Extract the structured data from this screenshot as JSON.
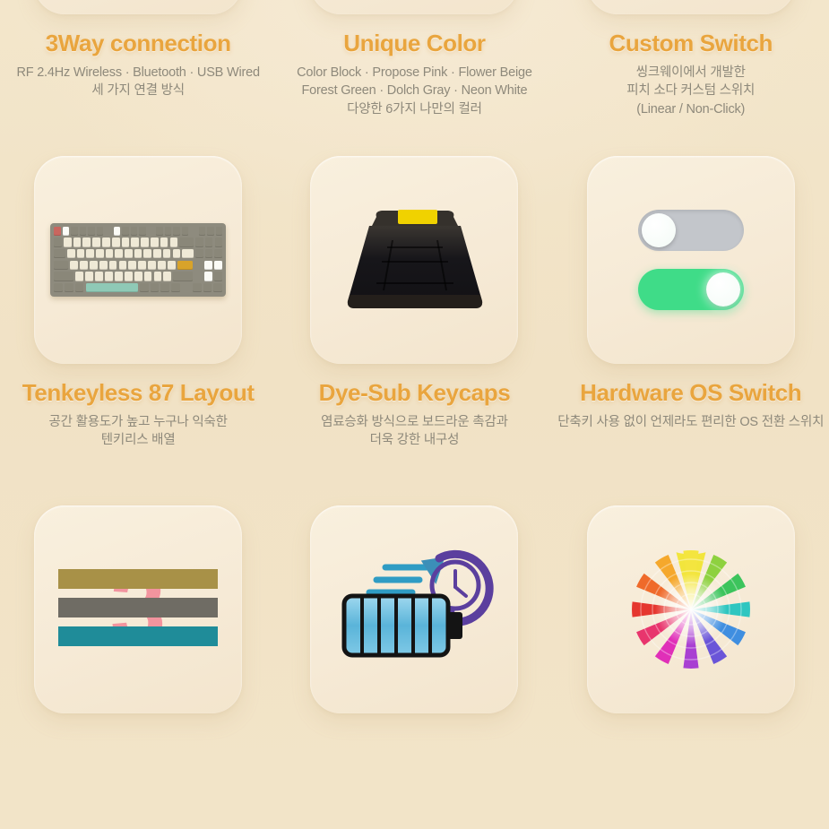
{
  "theme": {
    "page_background": "#f1e3c7",
    "card_background": "#f7ecd8",
    "title_color": "#e9a53e",
    "body_color": "#8e897b"
  },
  "features": [
    {
      "icon": "rainbow-triangle-icon",
      "title": "3Way connection",
      "desc": [
        "RF 2.4Hz Wireless · Bluetooth · USB Wired",
        "세 가지 연결 방식"
      ]
    },
    {
      "icon": "color-fan-deck-icon",
      "title": "Unique Color",
      "desc": [
        "Color Block · Propose Pink · Flower Beige",
        "Forest Green · Dolch Gray · Neon White",
        "다양한 6가지 나만의 컬러"
      ]
    },
    {
      "icon": "mechanical-switch-icon",
      "title": "Custom Switch",
      "desc": [
        "씽크웨이에서 개발한",
        "피치 소다 커스텀 스위치",
        "(Linear / Non-Click)"
      ]
    },
    {
      "icon": "tkl-keyboard-icon",
      "title": "Tenkeyless 87 Layout",
      "desc": [
        "공간 활용도가 높고 누구나 익숙한",
        "텐키리스 배열"
      ]
    },
    {
      "icon": "keycap-icon",
      "title": "Dye-Sub Keycaps",
      "desc": [
        "염료승화 방식으로 보드라운 촉감과",
        "더욱 강한 내구성"
      ]
    },
    {
      "icon": "os-toggle-switch-icon",
      "title": "Hardware OS Switch",
      "desc": [
        "단축키 사용 없이 언제라도 편리한 OS 전환 스위치"
      ]
    },
    {
      "icon": "three-stripes-icon",
      "title": "",
      "desc": []
    },
    {
      "icon": "battery-fast-charge-icon",
      "title": "",
      "desc": []
    },
    {
      "icon": "color-wheel-icon",
      "title": "",
      "desc": []
    }
  ]
}
